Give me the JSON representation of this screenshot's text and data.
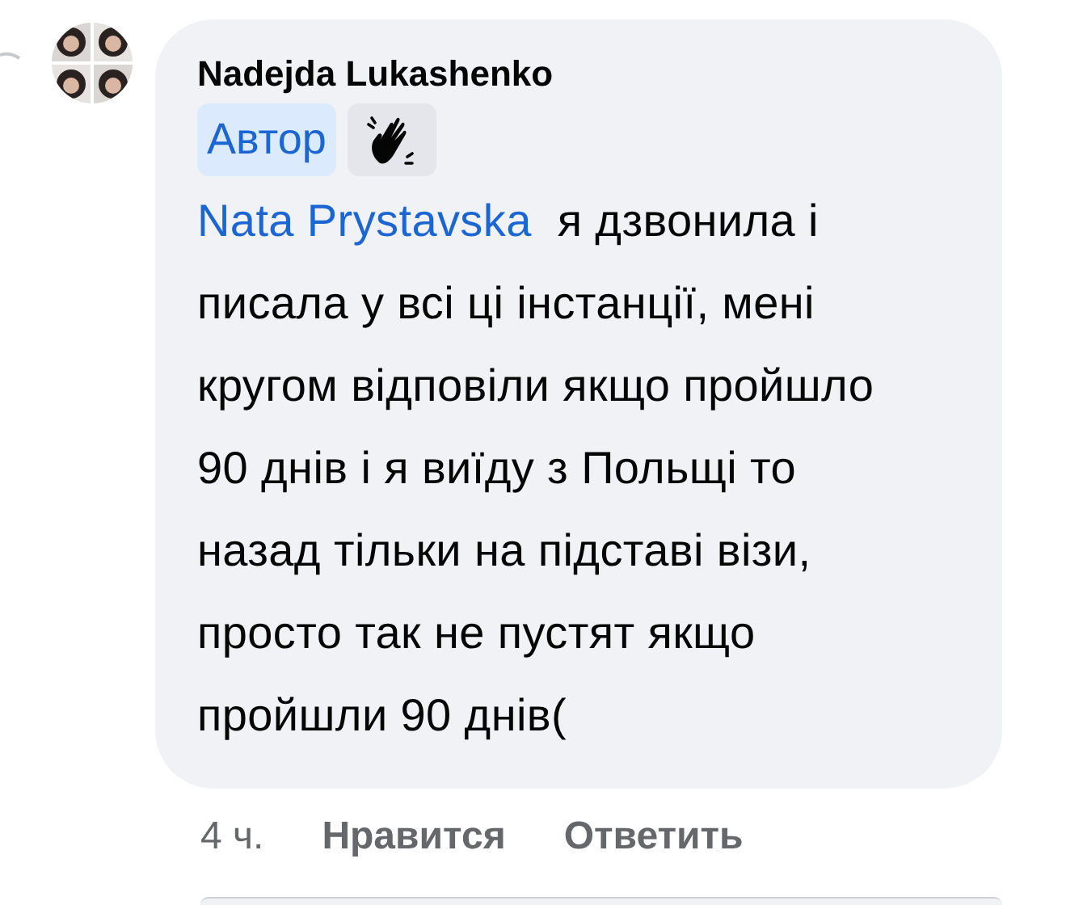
{
  "comment": {
    "author": "Nadejda Lukashenko",
    "badges": [
      {
        "kind": "label",
        "text": "Автор"
      },
      {
        "kind": "icon"
      }
    ],
    "mention": "Nata Prystavska",
    "text": "я дзвонила і писала у всі ці інстанції, мені кругом відповіли якщо пройшло 90 днів і я виїду з Польщі то назад тільки на підставі візи, просто так не пустят якщо пройшли 90 днів(",
    "time": "4 ч.",
    "actions": [
      "Нравится",
      "Ответить"
    ]
  }
}
